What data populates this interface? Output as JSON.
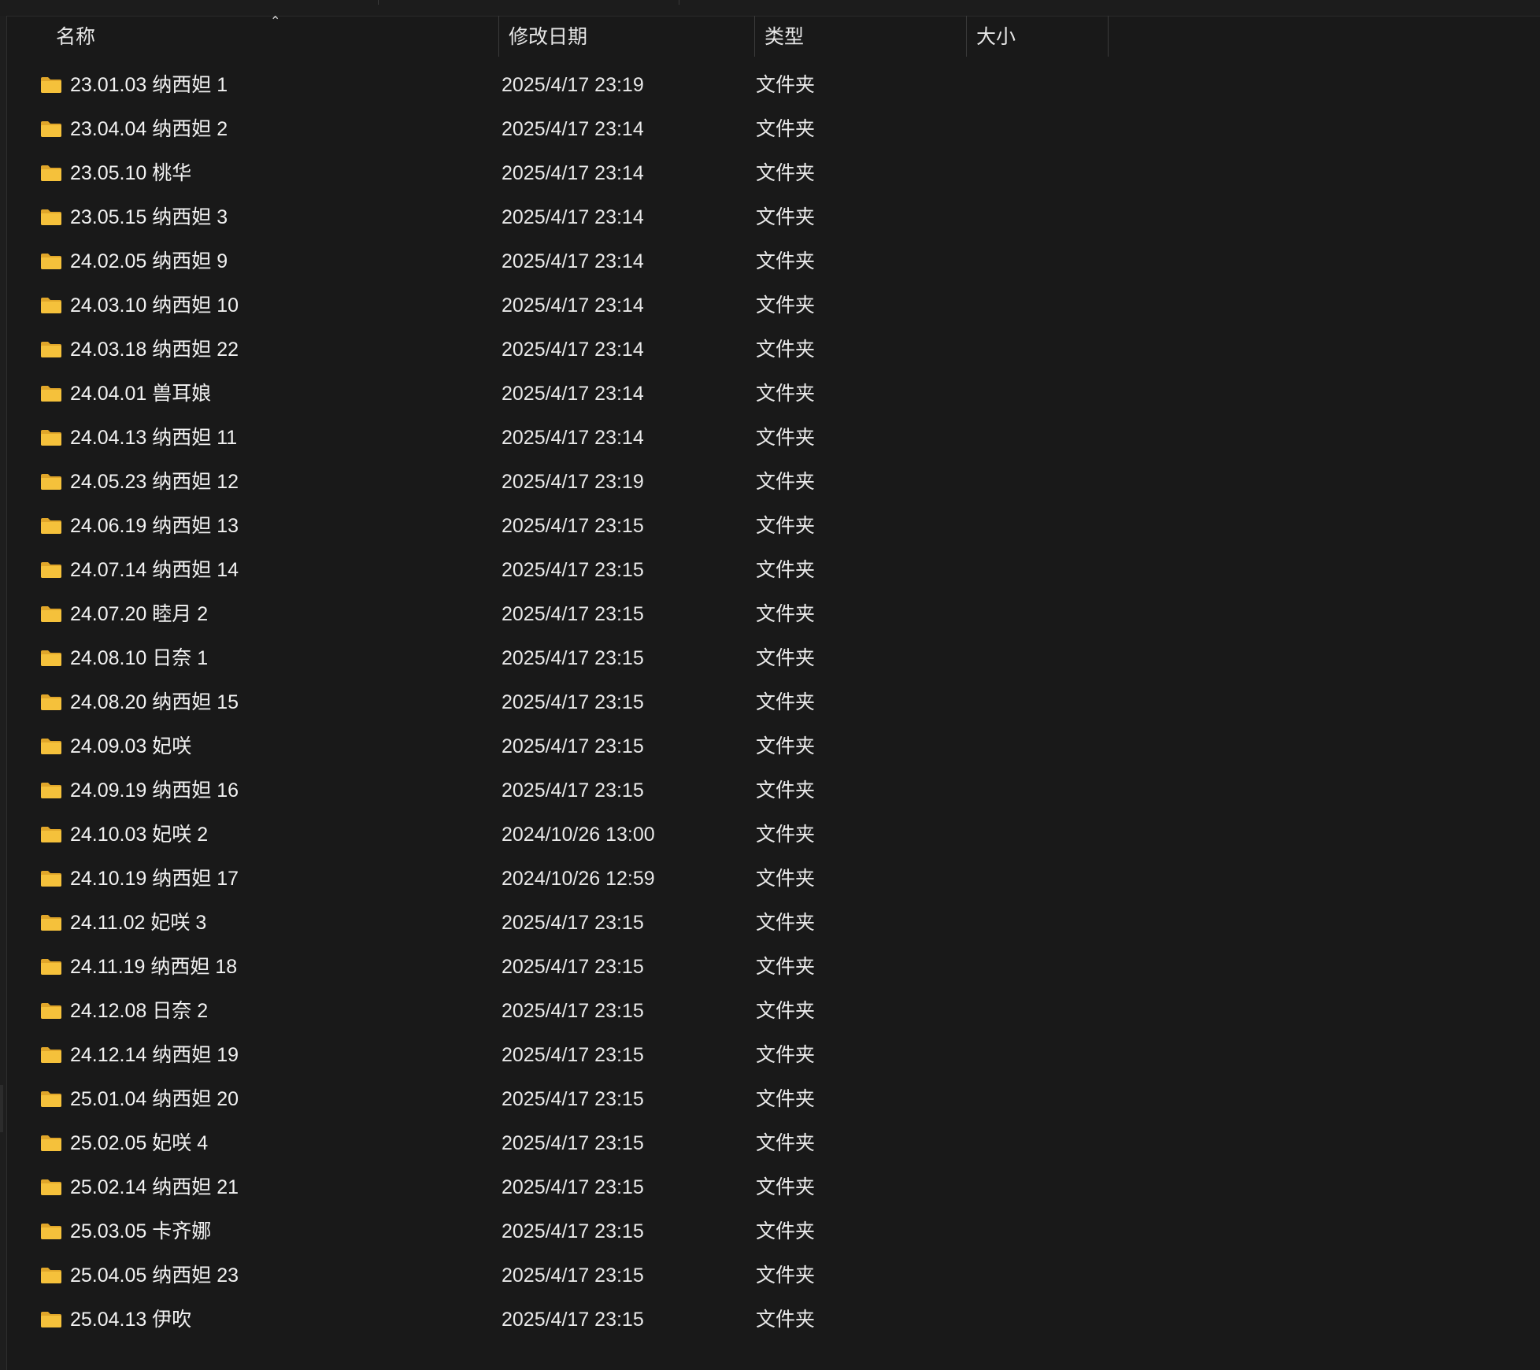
{
  "columns": {
    "name": "名称",
    "modified": "修改日期",
    "type": "类型",
    "size": "大小"
  },
  "sort": {
    "column": "name",
    "direction": "ascending",
    "icon": "chevron-up-icon"
  },
  "colors": {
    "background": "#191919",
    "folder": "#f5c13b",
    "folder_dark": "#e0a62a"
  },
  "rows": [
    {
      "name": "23.01.03 纳西妲 1",
      "modified": "2025/4/17 23:19",
      "type": "文件夹",
      "size": ""
    },
    {
      "name": "23.04.04 纳西妲 2",
      "modified": "2025/4/17 23:14",
      "type": "文件夹",
      "size": ""
    },
    {
      "name": "23.05.10 桃华",
      "modified": "2025/4/17 23:14",
      "type": "文件夹",
      "size": ""
    },
    {
      "name": "23.05.15 纳西妲 3",
      "modified": "2025/4/17 23:14",
      "type": "文件夹",
      "size": ""
    },
    {
      "name": "24.02.05 纳西妲 9",
      "modified": "2025/4/17 23:14",
      "type": "文件夹",
      "size": ""
    },
    {
      "name": "24.03.10 纳西妲 10",
      "modified": "2025/4/17 23:14",
      "type": "文件夹",
      "size": ""
    },
    {
      "name": "24.03.18 纳西妲 22",
      "modified": "2025/4/17 23:14",
      "type": "文件夹",
      "size": ""
    },
    {
      "name": "24.04.01 兽耳娘",
      "modified": "2025/4/17 23:14",
      "type": "文件夹",
      "size": ""
    },
    {
      "name": "24.04.13 纳西妲 11",
      "modified": "2025/4/17 23:14",
      "type": "文件夹",
      "size": ""
    },
    {
      "name": "24.05.23 纳西妲 12",
      "modified": "2025/4/17 23:19",
      "type": "文件夹",
      "size": ""
    },
    {
      "name": "24.06.19 纳西妲 13",
      "modified": "2025/4/17 23:15",
      "type": "文件夹",
      "size": ""
    },
    {
      "name": "24.07.14 纳西妲 14",
      "modified": "2025/4/17 23:15",
      "type": "文件夹",
      "size": ""
    },
    {
      "name": "24.07.20 睦月 2",
      "modified": "2025/4/17 23:15",
      "type": "文件夹",
      "size": ""
    },
    {
      "name": "24.08.10 日奈 1",
      "modified": "2025/4/17 23:15",
      "type": "文件夹",
      "size": ""
    },
    {
      "name": "24.08.20 纳西妲 15",
      "modified": "2025/4/17 23:15",
      "type": "文件夹",
      "size": ""
    },
    {
      "name": "24.09.03 妃咲",
      "modified": "2025/4/17 23:15",
      "type": "文件夹",
      "size": ""
    },
    {
      "name": "24.09.19 纳西妲 16",
      "modified": "2025/4/17 23:15",
      "type": "文件夹",
      "size": ""
    },
    {
      "name": "24.10.03 妃咲 2",
      "modified": "2024/10/26 13:00",
      "type": "文件夹",
      "size": ""
    },
    {
      "name": "24.10.19 纳西妲 17",
      "modified": "2024/10/26 12:59",
      "type": "文件夹",
      "size": ""
    },
    {
      "name": "24.11.02 妃咲 3",
      "modified": "2025/4/17 23:15",
      "type": "文件夹",
      "size": ""
    },
    {
      "name": "24.11.19 纳西妲 18",
      "modified": "2025/4/17 23:15",
      "type": "文件夹",
      "size": ""
    },
    {
      "name": "24.12.08 日奈 2",
      "modified": "2025/4/17 23:15",
      "type": "文件夹",
      "size": ""
    },
    {
      "name": "24.12.14 纳西妲 19",
      "modified": "2025/4/17 23:15",
      "type": "文件夹",
      "size": ""
    },
    {
      "name": "25.01.04 纳西妲 20",
      "modified": "2025/4/17 23:15",
      "type": "文件夹",
      "size": ""
    },
    {
      "name": "25.02.05 妃咲 4",
      "modified": "2025/4/17 23:15",
      "type": "文件夹",
      "size": ""
    },
    {
      "name": "25.02.14 纳西妲 21",
      "modified": "2025/4/17 23:15",
      "type": "文件夹",
      "size": ""
    },
    {
      "name": "25.03.05 卡齐娜",
      "modified": "2025/4/17 23:15",
      "type": "文件夹",
      "size": ""
    },
    {
      "name": "25.04.05 纳西妲 23",
      "modified": "2025/4/17 23:15",
      "type": "文件夹",
      "size": ""
    },
    {
      "name": "25.04.13 伊吹",
      "modified": "2025/4/17 23:15",
      "type": "文件夹",
      "size": ""
    }
  ]
}
